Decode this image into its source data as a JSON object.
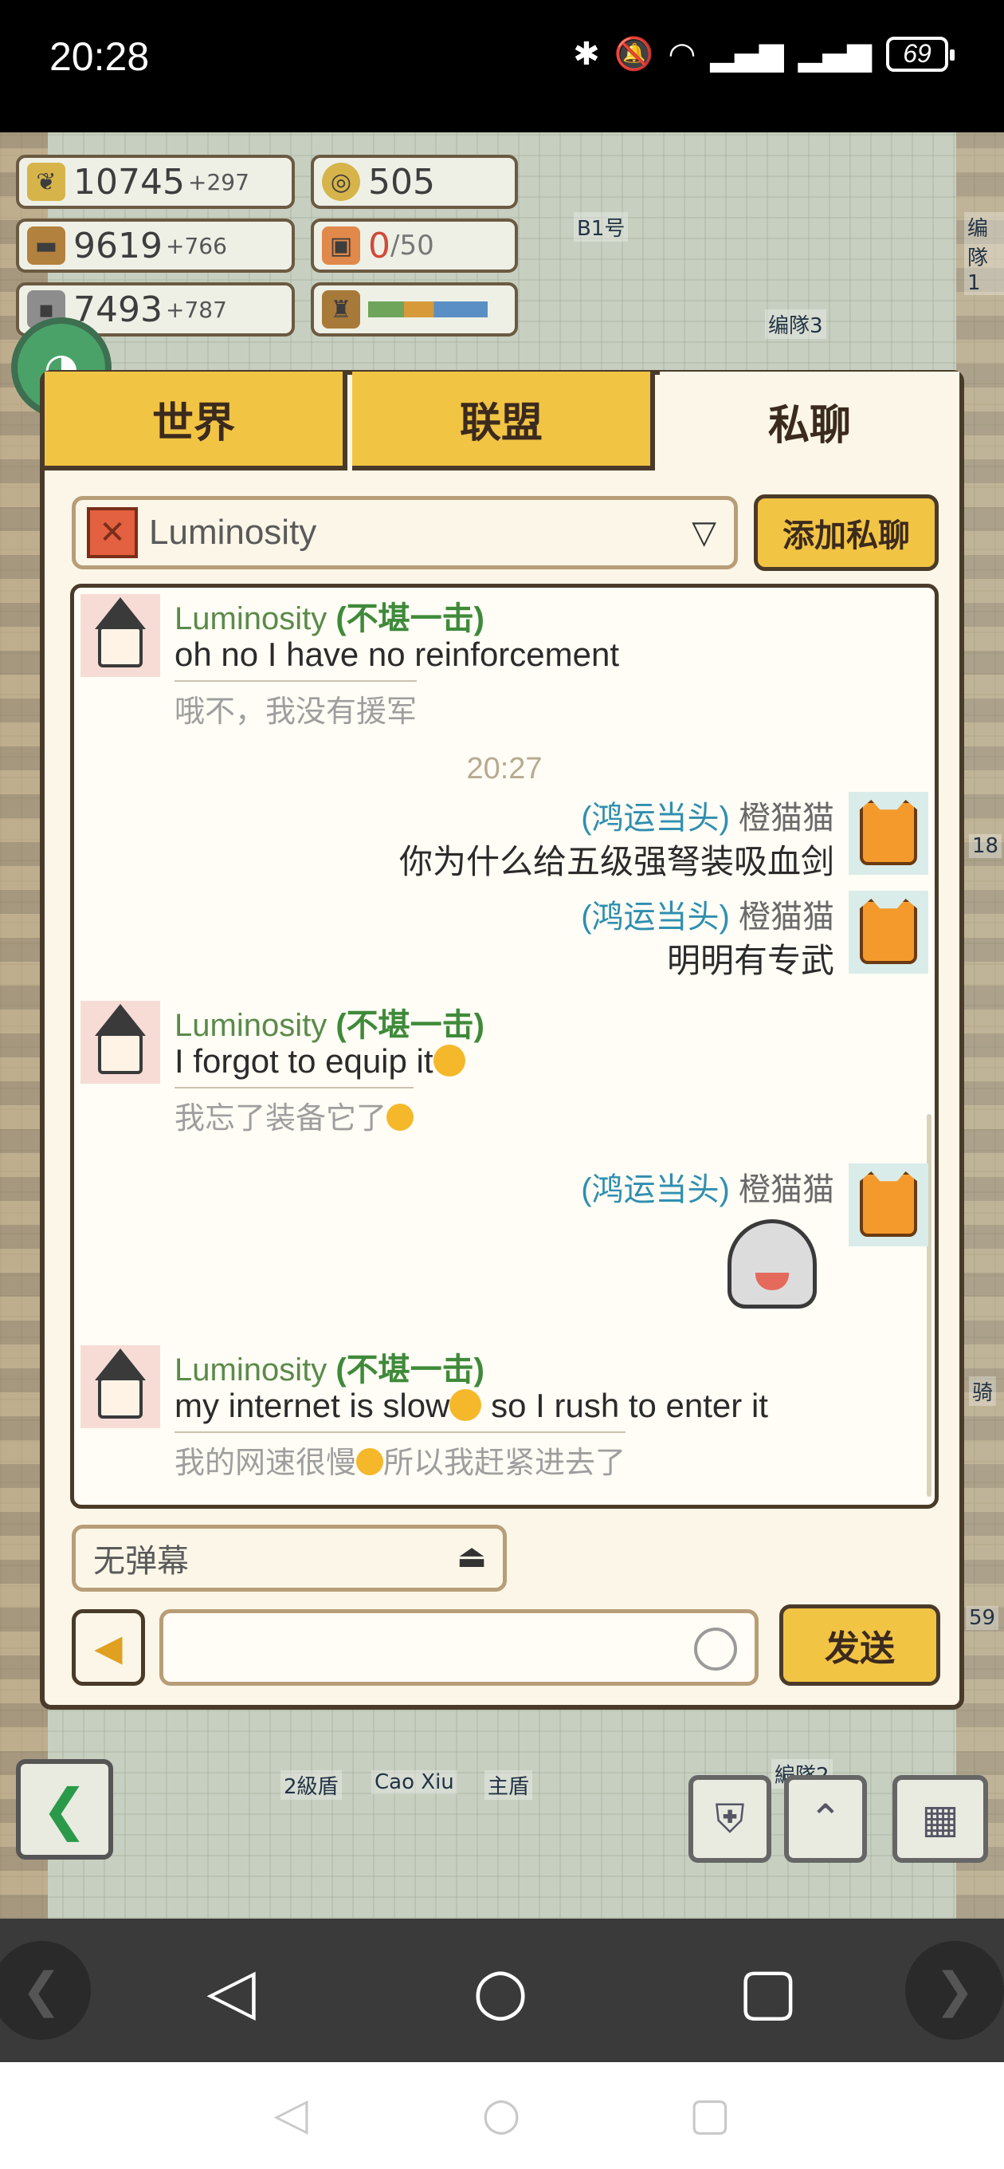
{
  "status_bar": {
    "time": "20:28",
    "battery": "69"
  },
  "resources": {
    "wheat": {
      "value": "10745",
      "delta": "+297"
    },
    "wood": {
      "value": "9619",
      "delta": "+766"
    },
    "stone": {
      "value": "7493",
      "delta": "+787"
    },
    "coins": {
      "value": "505"
    },
    "gifts": {
      "value": "0",
      "max": "/50"
    }
  },
  "map_labels": [
    "B1号",
    "编隊3",
    "编隊1",
    "2級盾",
    "Cao Xiu",
    "主盾",
    "編隊2",
    "骑",
    "18",
    "59"
  ],
  "tabs": {
    "world": "世界",
    "alliance": "联盟",
    "private": "私聊"
  },
  "contact": {
    "name": "Luminosity"
  },
  "add_private_label": "添加私聊",
  "messages": [
    {
      "sender": "Luminosity",
      "title": "(不堪一击)",
      "text": "oh no I have no reinforcement",
      "translation": "哦不，我没有援军"
    },
    {
      "time": "20:27"
    },
    {
      "sender": "橙猫猫",
      "title": "(鸿运当头)",
      "text": "你为什么给五级强弩装吸血剑"
    },
    {
      "sender": "橙猫猫",
      "title": "(鸿运当头)",
      "text": "明明有专武"
    },
    {
      "sender": "Luminosity",
      "title": "(不堪一击)",
      "text": "I forgot to equip it",
      "translation": "我忘了装备它了"
    },
    {
      "sender": "橙猫猫",
      "title": "(鸿运当头)",
      "sticker": "crying-face"
    },
    {
      "sender": "Luminosity",
      "title": "(不堪一击)",
      "text_a": "my internet is slow",
      "text_b": " so I rush to enter it",
      "translation_a": "我的网速很慢",
      "translation_b": "所以我赶紧进去了"
    }
  ],
  "danmaku": {
    "label": "无弹幕"
  },
  "send_label": "发送",
  "colors": {
    "accent": "#f2c443",
    "border": "#4a3a2a",
    "panel": "#fbf6e7"
  }
}
